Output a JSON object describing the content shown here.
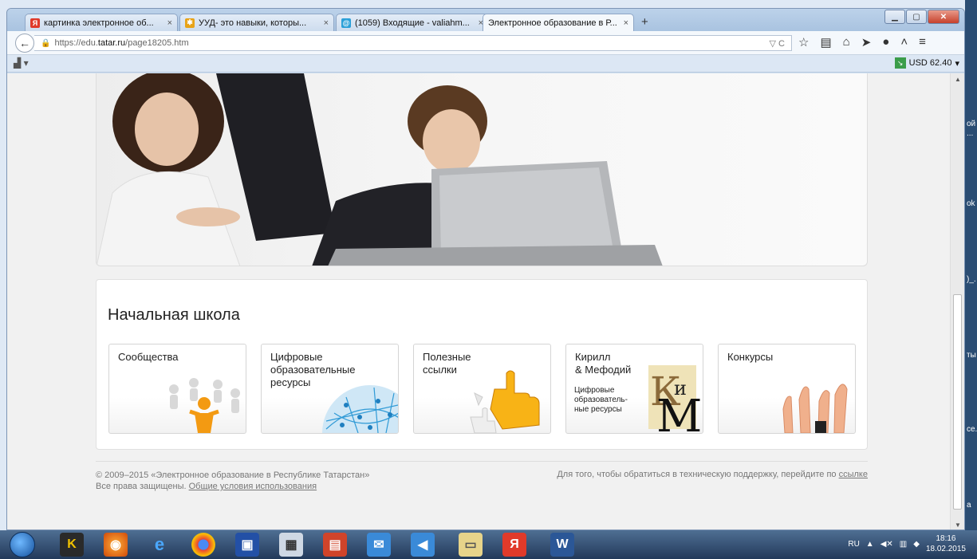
{
  "browser": {
    "tabs": [
      {
        "label": "картинка электронное об...",
        "icon_color": "#e03a2a",
        "icon_char": "Я"
      },
      {
        "label": "УУД- это навыки, которы...",
        "icon_color": "#e8a317",
        "icon_char": "✱"
      },
      {
        "label": "(1059) Входящие - valiahm...",
        "icon_color": "#2ba0d8",
        "icon_char": "@"
      },
      {
        "label": "Электронное образование в Р..."
      }
    ],
    "tab_close": "×",
    "new_tab": "+",
    "url_prefix": "https://edu.",
    "url_domain": "tatar.ru",
    "url_path": "/page18205.htm",
    "url_right": "▽ C",
    "currency": "USD 62.40",
    "window_buttons": {
      "minimize": "▁",
      "maximize": "▢",
      "close": "✕"
    }
  },
  "page": {
    "section_title": "Начальная школа",
    "cards": [
      {
        "title": "Сообщества"
      },
      {
        "title": "Цифровые\nобразовательные\nресурсы"
      },
      {
        "title": "Полезные\nссылки"
      },
      {
        "title": "Кирилл\n& Мефодий",
        "subtitle": "Цифровые\nобразователь-\nные ресурсы"
      },
      {
        "title": "Конкурсы"
      }
    ],
    "footer": {
      "copyright": "© 2009–2015 «Электронное образование в Республике Татарстан»",
      "rights": "Все права защищены.",
      "terms_link": "Общие условия использования",
      "support_text": "Для того, чтобы обратиться в техническую поддержку, перейдите по",
      "support_link": "ссылке"
    }
  },
  "taskbar": {
    "lang": "RU",
    "time": "18:16",
    "date": "18.02.2015"
  },
  "right_edge_text": [
    "ой",
    "...",
    "ok",
    ")_.",
    "ты",
    "ce.",
    "а"
  ],
  "colors": {
    "accent": "#2b4d73",
    "card_border": "#d5d5d5"
  }
}
